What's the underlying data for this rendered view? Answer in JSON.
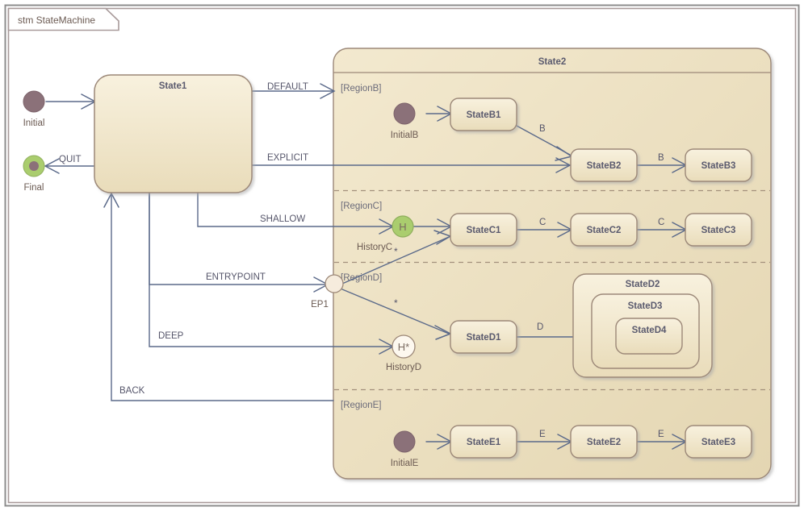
{
  "frame": {
    "label": "stm StateMachine",
    "border_color": "#a89a9a",
    "outer_border_color": "#8c8c8c"
  },
  "palette": {
    "state_fill_light": "#f7eed6",
    "state_fill_dark": "#ece0bf",
    "state_border": "#9c8878",
    "composite_fill": "#ecdfc0",
    "line": "#5b6a8a",
    "initial_fill": "#8b7179",
    "final_ring": "#aacd6e",
    "history_green": "#aacd6e",
    "history_white": "#fdf8ef",
    "entrypoint_fill": "#f6ecdd",
    "text_state": "#5a5a6e",
    "text_node": "#6b5a52",
    "text_region": "#6b6b7a"
  },
  "pseudostates": {
    "initial": {
      "name": "Initial",
      "kind": "initial-node"
    },
    "final": {
      "name": "Final",
      "kind": "final-node"
    },
    "initialB": {
      "name": "InitialB",
      "kind": "initial-node"
    },
    "historyC": {
      "name": "HistoryC",
      "kind": "shallow-history-node",
      "glyph": "H"
    },
    "historyD": {
      "name": "HistoryD",
      "kind": "deep-history-node",
      "glyph": "H*"
    },
    "entrypoint": {
      "name": "EP1",
      "kind": "entry-point-node"
    },
    "initialE": {
      "name": "InitialE",
      "kind": "initial-node"
    }
  },
  "states": {
    "state1": {
      "name": "State1"
    },
    "state2": {
      "name": "State2"
    },
    "stateB1": {
      "name": "StateB1"
    },
    "stateB2": {
      "name": "StateB2"
    },
    "stateB3": {
      "name": "StateB3"
    },
    "stateC1": {
      "name": "StateC1"
    },
    "stateC2": {
      "name": "StateC2"
    },
    "stateC3": {
      "name": "StateC3"
    },
    "stateD1": {
      "name": "StateD1"
    },
    "stateD2": {
      "name": "StateD2"
    },
    "stateD3": {
      "name": "StateD3"
    },
    "stateD4": {
      "name": "StateD4"
    },
    "stateE1": {
      "name": "StateE1"
    },
    "stateE2": {
      "name": "StateE2"
    },
    "stateE3": {
      "name": "StateE3"
    }
  },
  "regions": {
    "regionB": {
      "label": "[RegionB]"
    },
    "regionC": {
      "label": "[RegionC]"
    },
    "regionD": {
      "label": "[RegionD]"
    },
    "regionE": {
      "label": "[RegionE]"
    }
  },
  "transitions": {
    "default": {
      "label": "DEFAULT"
    },
    "explicit": {
      "label": "EXPLICIT"
    },
    "shallow": {
      "label": "SHALLOW"
    },
    "entrypoint": {
      "label": "ENTRYPOINT"
    },
    "deep": {
      "label": "DEEP"
    },
    "back": {
      "label": "BACK"
    },
    "quit": {
      "label": "QUIT"
    },
    "b1_b2": {
      "label": "B"
    },
    "b2_b3": {
      "label": "B"
    },
    "c1_c2": {
      "label": "C"
    },
    "c2_c3": {
      "label": "C"
    },
    "d1_d4": {
      "label": "D"
    },
    "e1_e2": {
      "label": "E"
    },
    "e2_e3": {
      "label": "E"
    },
    "ep_c1": {
      "label": "*"
    },
    "ep_d1": {
      "label": "*"
    }
  }
}
